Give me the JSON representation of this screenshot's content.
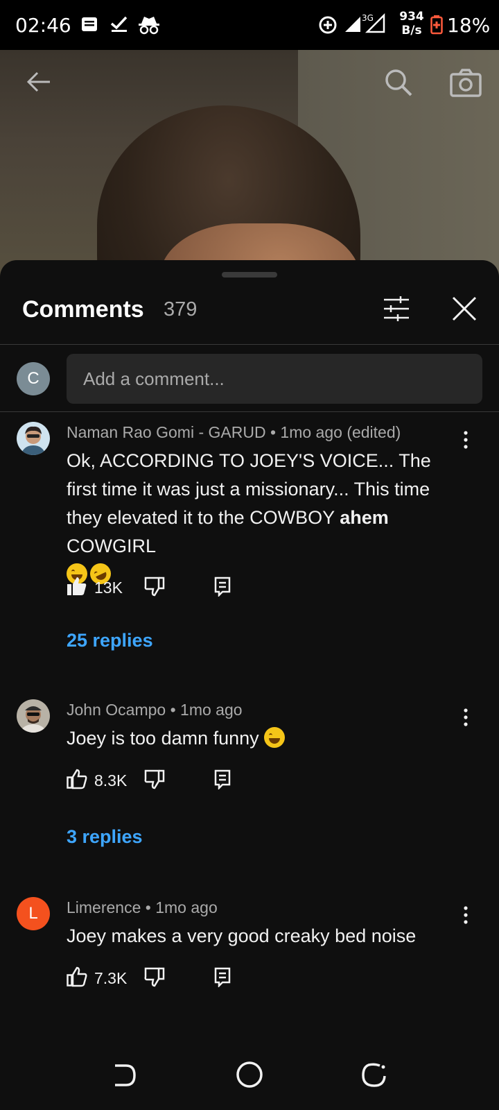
{
  "status_bar": {
    "time": "02:46",
    "net_speed_value": "934",
    "net_speed_unit": "B/s",
    "network_type": "3G",
    "battery_percent": "18%",
    "icons": [
      "notes-icon",
      "check-icon",
      "incognito-icon",
      "data-saver-icon",
      "signal-icon",
      "signal-3g-icon",
      "battery-low-icon"
    ]
  },
  "video": {
    "icons": [
      "back-arrow-icon",
      "search-icon",
      "camera-icon"
    ]
  },
  "comments_panel": {
    "title": "Comments",
    "count": "379",
    "add_comment_placeholder": "Add a comment...",
    "own_avatar_letter": "C",
    "icons": [
      "filter-sliders-icon",
      "close-icon"
    ]
  },
  "comments": [
    {
      "author": "Naman Rao Gomi - GARUD",
      "time": "1mo ago (edited)",
      "text_before": "Ok, ACCORDING TO JOEY'S VOICE... The first time it was just a missionary... This time they elevated it to the COWBOY ",
      "text_bold": "ahem",
      "text_after": " COWGIRL",
      "emojis": [
        "joy-emoji",
        "rofl-emoji"
      ],
      "likes": "13K",
      "liked": true,
      "replies": "25 replies"
    },
    {
      "author": "John Ocampo",
      "time": "1mo ago",
      "text": "Joey is too damn funny",
      "emojis": [
        "joy-emoji"
      ],
      "likes": "8.3K",
      "liked": false,
      "replies": "3 replies"
    },
    {
      "author": "Limerence",
      "time": "1mo ago",
      "avatar_letter": "L",
      "avatar_color": "#f4511e",
      "text": "Joey makes a very good creaky bed noise",
      "likes": "7.3K",
      "liked": false
    }
  ],
  "separator": " • ",
  "colors": {
    "background": "#0f0f0f",
    "link_blue": "#3ea6ff",
    "secondary_text": "#aaaaaa",
    "input_bg": "#272727"
  },
  "nav_bar": {
    "icons": [
      "back-gesture-icon",
      "home-circle-icon",
      "recents-icon"
    ]
  }
}
